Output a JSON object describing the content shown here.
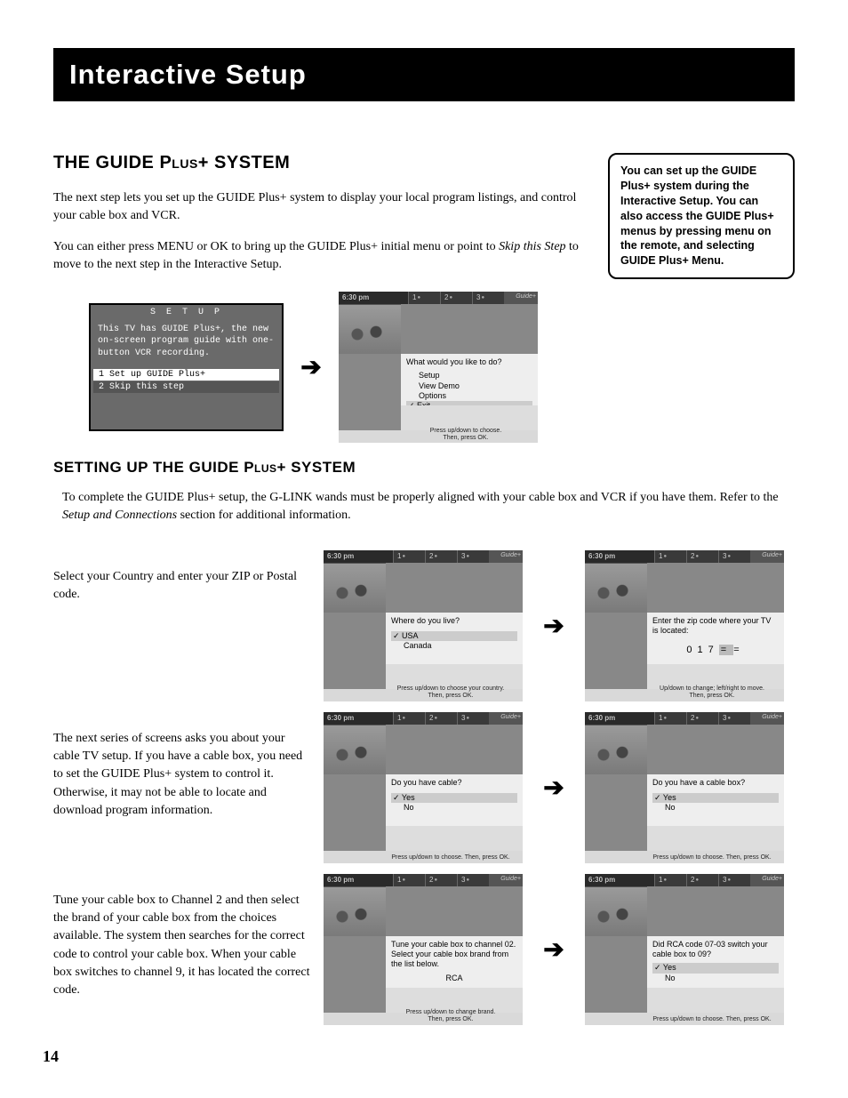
{
  "title_bar": "Interactive Setup",
  "page_number": "14",
  "section": {
    "heading": "THE GUIDE Plus+ SYSTEM",
    "p1": "The next step lets you set up the GUIDE Plus+ system to display your local program listings, and control your cable box and VCR.",
    "p2_a": "You can either press MENU or OK to bring up the GUIDE Plus+ initial menu or point to ",
    "p2_em": "Skip this Step",
    "p2_b": " to move to the next step in the Interactive Setup."
  },
  "sidebar": "You can set up the GUIDE Plus+ system during the Interactive Setup. You can also access the GUIDE Plus+ menus by pressing menu on the remote, and selecting GUIDE Plus+ Menu.",
  "setup_screen": {
    "header": "S E T U P",
    "blurb": "This TV has GUIDE Plus+, the new on-screen program guide with one-button VCR recording.",
    "item1": "1 Set up GUIDE Plus+",
    "item2": "2 Skip this step"
  },
  "guide_common": {
    "time": "6:30 pm",
    "slot1": "1",
    "slot2": "2",
    "slot3": "3",
    "logo": "Guide+"
  },
  "screen_initial": {
    "prompt": "What would you like to do?",
    "opts": [
      "Setup",
      "View Demo",
      "Options",
      "Exit"
    ],
    "sel_index": 3,
    "footer": "Press up/down to choose.\nThen, press OK."
  },
  "subsection": {
    "heading": "SETTING UP THE GUIDE Plus+ SYSTEM",
    "intro_a": "To complete the GUIDE Plus+ setup, the G-LINK wands must be properly aligned with your cable box and VCR if you have them. Refer to the ",
    "intro_em": "Setup and Connections",
    "intro_b": " section for additional information."
  },
  "step1": {
    "text": "Select your Country and enter your ZIP or Postal code.",
    "screenA": {
      "prompt": "Where do you live?",
      "opts": [
        "USA",
        "Canada"
      ],
      "sel_index": 0,
      "footer": "Press up/down to choose your country.\nThen, press OK."
    },
    "screenB": {
      "prompt": "Enter the zip code where your TV is located:",
      "digits": [
        "0",
        "1",
        "7",
        "=",
        "="
      ],
      "cur_index": 3,
      "footer": "Up/down to change; left/right to move.\nThen, press OK."
    }
  },
  "step2": {
    "text": "The next series of screens asks you about your cable TV setup. If you have a cable box, you need to set the GUIDE Plus+ system to control it. Otherwise, it may not be able to locate and download program information.",
    "screenA": {
      "prompt": "Do you have cable?",
      "opts": [
        "Yes",
        "No"
      ],
      "sel_index": 0,
      "footer": "Press up/down to choose. Then, press OK."
    },
    "screenB": {
      "prompt": "Do you have a cable box?",
      "opts": [
        "Yes",
        "No"
      ],
      "sel_index": 0,
      "footer": "Press up/down to choose. Then, press OK."
    }
  },
  "step3": {
    "text": "Tune your cable box to Channel 2 and then select the brand of your cable box from the choices available. The system then searches for the correct code to control your cable box. When your cable box switches to channel 9, it has located the correct code.",
    "screenA": {
      "prompt": "Tune your cable box to channel 02. Select your cable box brand from the list below.",
      "brand": "RCA",
      "footer": "Press up/down to change brand.\nThen, press OK."
    },
    "screenB": {
      "prompt": "Did RCA code 07-03 switch your cable box to 09?",
      "opts": [
        "Yes",
        "No"
      ],
      "sel_index": 0,
      "footer": "Press up/down to choose. Then, press OK."
    }
  }
}
